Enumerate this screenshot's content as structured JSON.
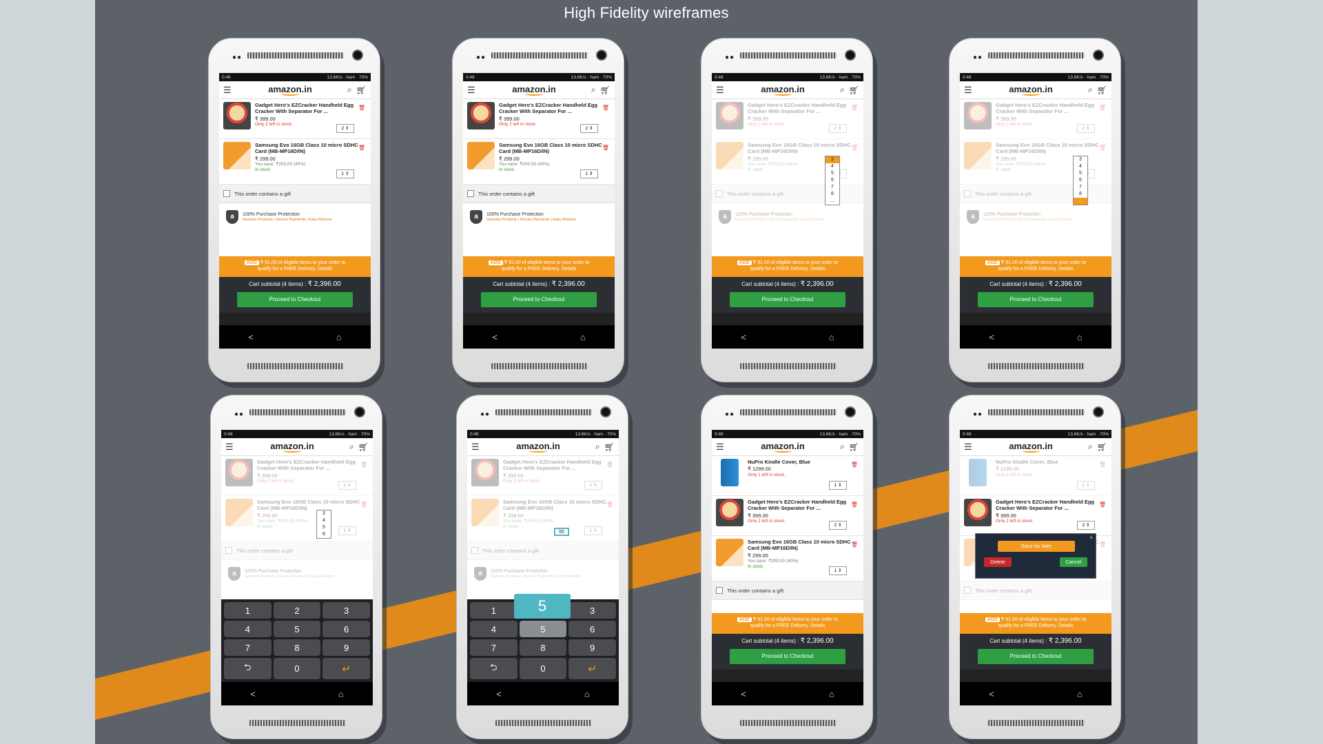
{
  "board": {
    "title": "High Fidelity wireframes",
    "accent_stripe": "#f39a1e",
    "background": "#5d6269"
  },
  "status": {
    "time": "0:48",
    "speed": "13.6K/s",
    "carrier": "ham",
    "battery": "70%"
  },
  "appbar": {
    "logo": "amazon.in",
    "menu_icon": "menu-icon",
    "search_icon": "search-icon",
    "cart_icon": "cart-icon"
  },
  "items": {
    "egg": {
      "title": "Gadget Hero's EZCracker Handheld Egg Cracker With Separator For ...",
      "price": "₹ 399.00",
      "stock": "Only 2 left in stock.",
      "qty": "2"
    },
    "sd": {
      "title": "Samsung Evo 16GB Class 10 micro SDHC Card (MB-MP16D/IN)",
      "price": "₹ 299.00",
      "save": "You save: ₹200.00 (40%)",
      "stock": "In stock",
      "qty": "1"
    },
    "kindle": {
      "title": "NuPro Kindle Cover, Blue",
      "price": "₹ 1299.00",
      "stock": "Only 1 left in stock.",
      "qty": "1"
    }
  },
  "gift": {
    "label": "This order contains a gift"
  },
  "protection": {
    "title": "100% Purchase Protection",
    "subtitle": "Genuine Products | Secure Payments | Easy Returns"
  },
  "promo": {
    "badge": "ADD",
    "line1": "₹ 91.00 of eligible items to your order to",
    "line2": "qualify for a FREE Delivery. Details"
  },
  "cart": {
    "subtotal_label": "Cart subtotal (4 items) :",
    "subtotal_value": "₹ 2,396.00",
    "checkout": "Proceed to Checkout"
  },
  "nav": {
    "back": "<",
    "home": "⌂"
  },
  "dropdown": {
    "values": [
      "3",
      "4",
      "5",
      "6",
      "7",
      "8"
    ],
    "more": "..."
  },
  "keypad": {
    "keys": [
      "1",
      "2",
      "3",
      "4",
      "5",
      "6",
      "7",
      "8",
      "9",
      "⮌",
      "0",
      "↵"
    ],
    "bubble": "5",
    "typed": "55"
  },
  "popup": {
    "save_for_later": "Save for later",
    "delete": "Delete",
    "cancel": "Cancel",
    "close": "×"
  }
}
